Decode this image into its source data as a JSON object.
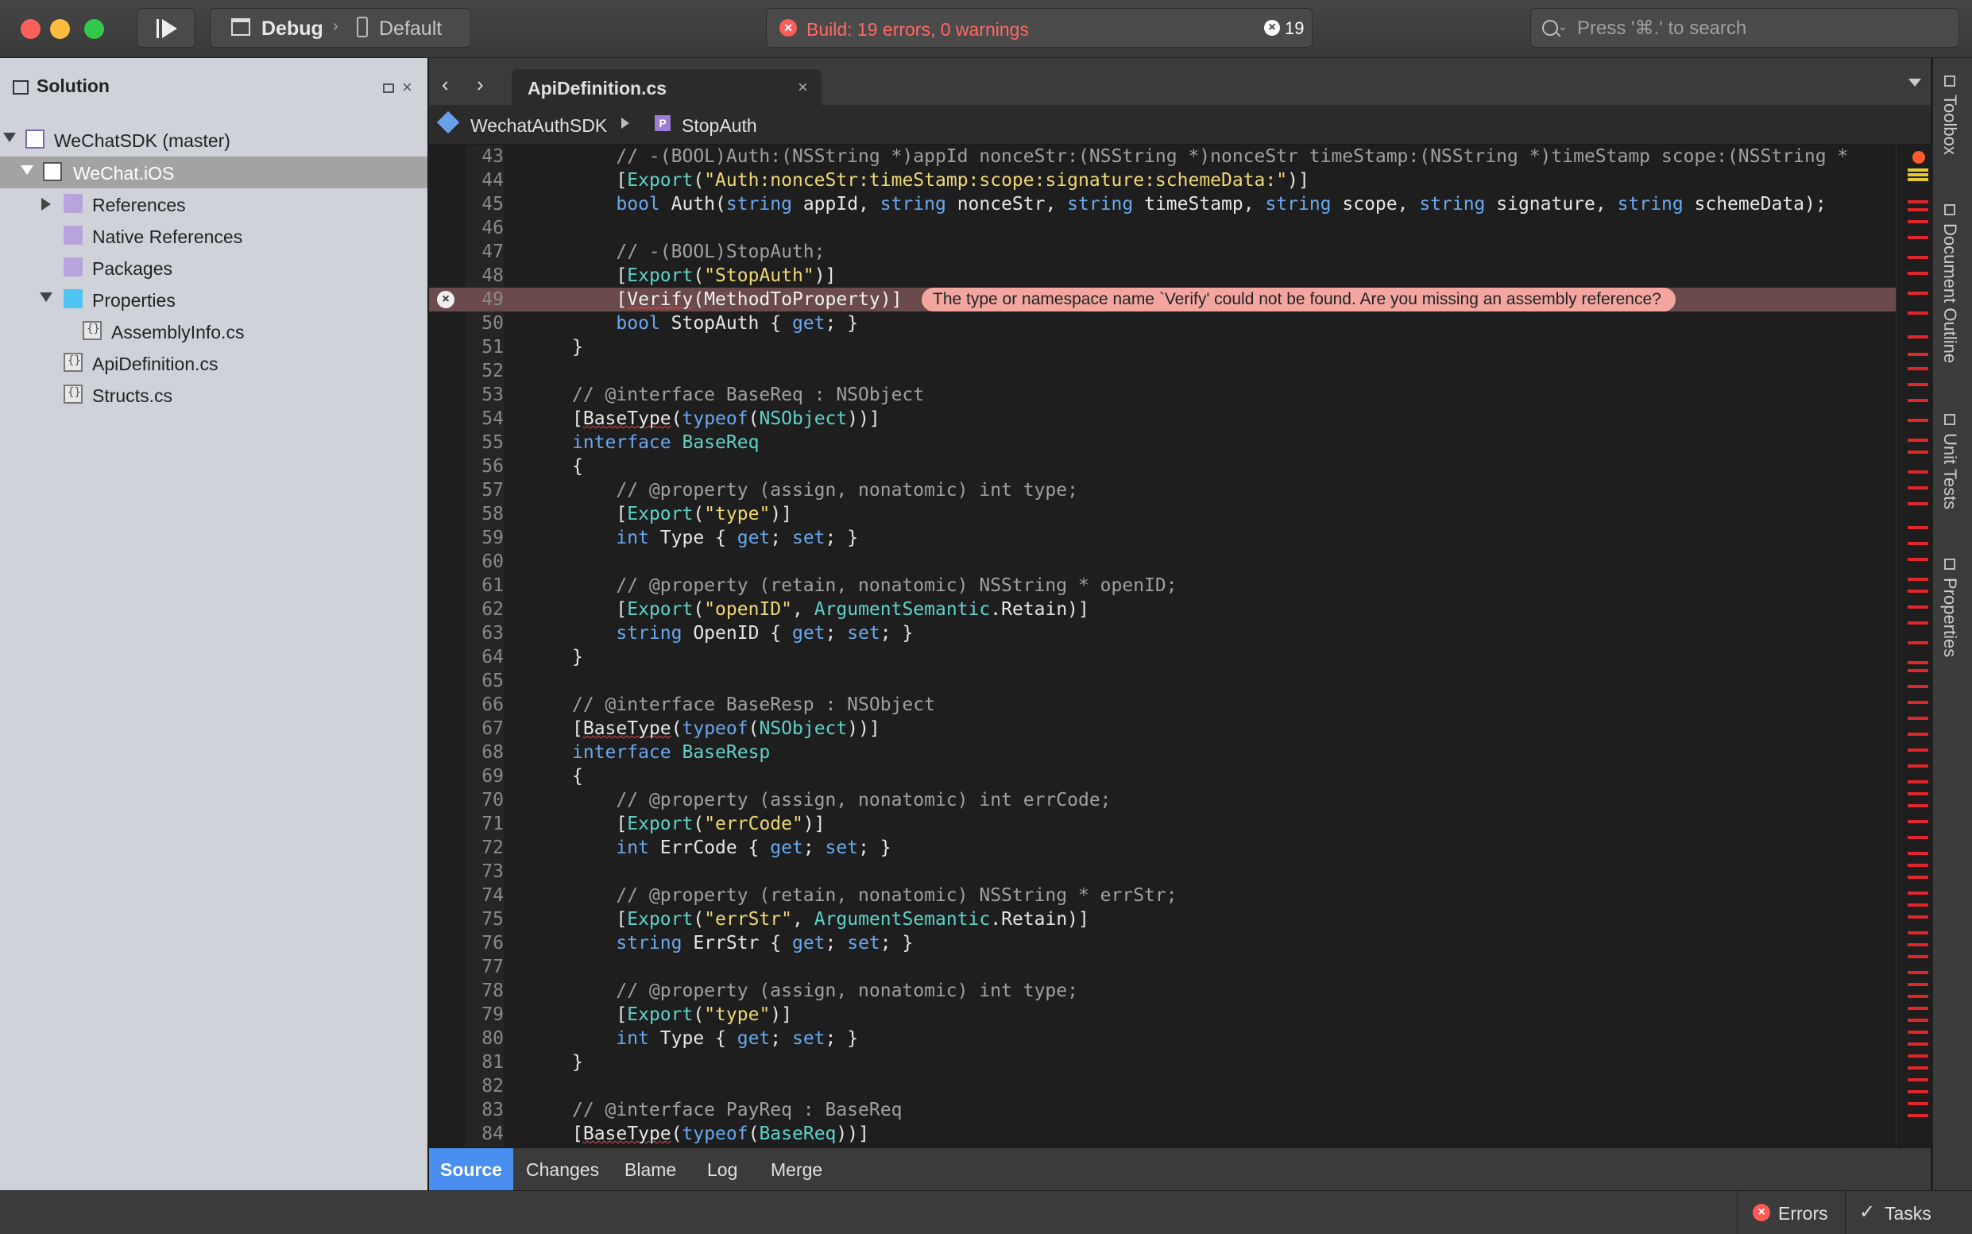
{
  "toolbar": {
    "config_label": "Debug",
    "config_sep": "›",
    "device_label": "Default",
    "status_text": "Build: 19 errors, 0 warnings",
    "error_count": "19",
    "search_placeholder": "Press '⌘.' to search"
  },
  "solution": {
    "title": "Solution",
    "items": [
      {
        "label": "WeChatSDK (master)"
      },
      {
        "label": "WeChat.iOS"
      },
      {
        "label": "References"
      },
      {
        "label": "Native References"
      },
      {
        "label": "Packages"
      },
      {
        "label": "Properties"
      },
      {
        "label": "AssemblyInfo.cs"
      },
      {
        "label": "ApiDefinition.cs"
      },
      {
        "label": "Structs.cs"
      }
    ]
  },
  "editor": {
    "tab_label": "ApiDefinition.cs",
    "breadcrumb_namespace": "WechatAuthSDK",
    "breadcrumb_member": "StopAuth",
    "error_message": "The type or namespace name `Verify' could not be found. Are you missing an assembly reference?",
    "line_numbers": [
      "43",
      "44",
      "45",
      "46",
      "47",
      "48",
      "49",
      "50",
      "51",
      "52",
      "53",
      "54",
      "55",
      "56",
      "57",
      "58",
      "59",
      "60",
      "61",
      "62",
      "63",
      "64",
      "65",
      "66",
      "67",
      "68",
      "69",
      "70",
      "71",
      "72",
      "73",
      "74",
      "75",
      "76",
      "77",
      "78",
      "79",
      "80",
      "81",
      "82",
      "83",
      "84"
    ]
  },
  "side_pads": [
    "Toolbox",
    "Document Outline",
    "Unit Tests",
    "Properties"
  ],
  "bottom_tabs": [
    "Source",
    "Changes",
    "Blame",
    "Log",
    "Merge"
  ],
  "statusbar": {
    "errors_label": "Errors",
    "tasks_label": "Tasks"
  },
  "colors": {
    "keyword": "#6ba8ee",
    "string": "#f0d874",
    "type": "#5fd3c8",
    "comment": "#a0a0a0",
    "error": "#ff5b57",
    "accent": "#4a8ef0"
  }
}
